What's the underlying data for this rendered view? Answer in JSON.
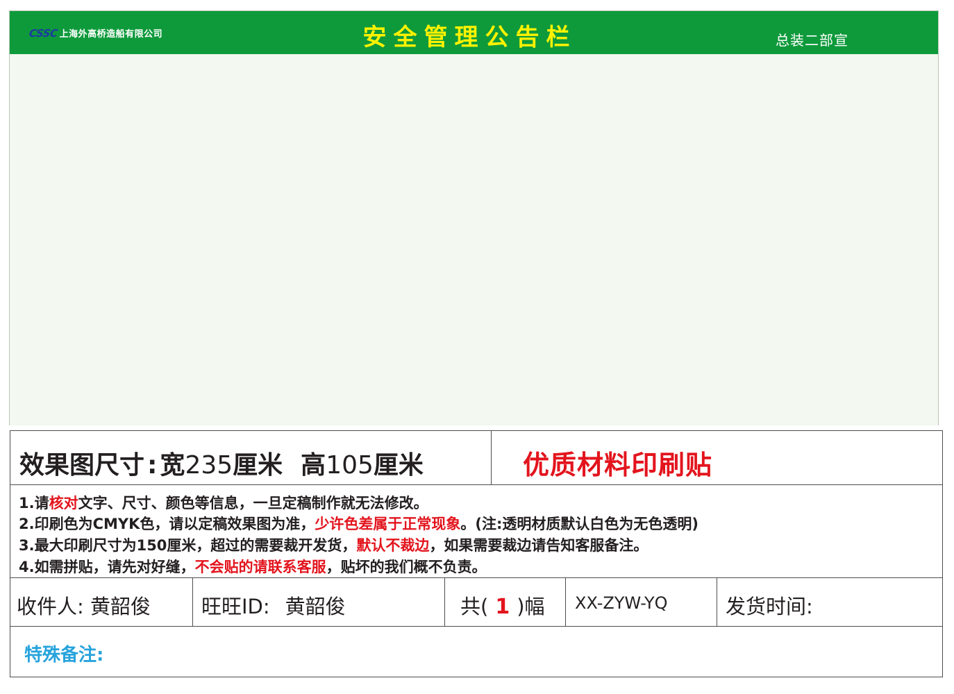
{
  "board": {
    "logo": "CSSC",
    "company": "上海外高桥造船有限公司",
    "title": "安全管理公告栏",
    "dept": "总装二部宣",
    "colors": {
      "header_green": "#0e9a3b",
      "title_yellow": "#fff200",
      "panel_bg": "#f3f8f0"
    }
  },
  "spec": {
    "size_label": "效果图尺寸",
    "size_colon": ":",
    "width_label": "宽",
    "width_value": "235",
    "unit": "厘米",
    "height_label": "高",
    "height_value": "105",
    "material": "优质材料印刷贴",
    "notes": {
      "n1": {
        "a": "1.请",
        "b": "核对",
        "c": "文字、尺寸、颜色等信息，一旦定稿制作就无法修改。"
      },
      "n2": {
        "a": "2.印刷色为CMYK色，请以定稿效果图为准，",
        "b": "少许色差属于正常现象",
        "c": "。(注:透明材质默认白色为无色透明)"
      },
      "n3": {
        "a": "3.最大印刷尺寸为150厘米，超过的需要裁开发货，",
        "b": "默认不裁边",
        "c": "，如果需要裁边请告知客服备注。"
      },
      "n4": {
        "a": "4.如需拼贴，请先对好缝，",
        "b": "不会贴的请联系客服",
        "c": "，贴坏的我们概不负责。"
      }
    },
    "recipient_label": "收件人:",
    "recipient_name": "黄韶俊",
    "wangwang_label": "旺旺ID:",
    "wangwang_id": "黄韶俊",
    "count_prefix": "共(",
    "count_value": "1",
    "count_suffix": ")幅",
    "code": "XX-ZYW-YQ",
    "ship_time_label": "发货时间:",
    "special_note_label": "特殊备注:",
    "colors": {
      "accent_red": "#e3141d",
      "note_blue": "#27a3dc"
    }
  }
}
